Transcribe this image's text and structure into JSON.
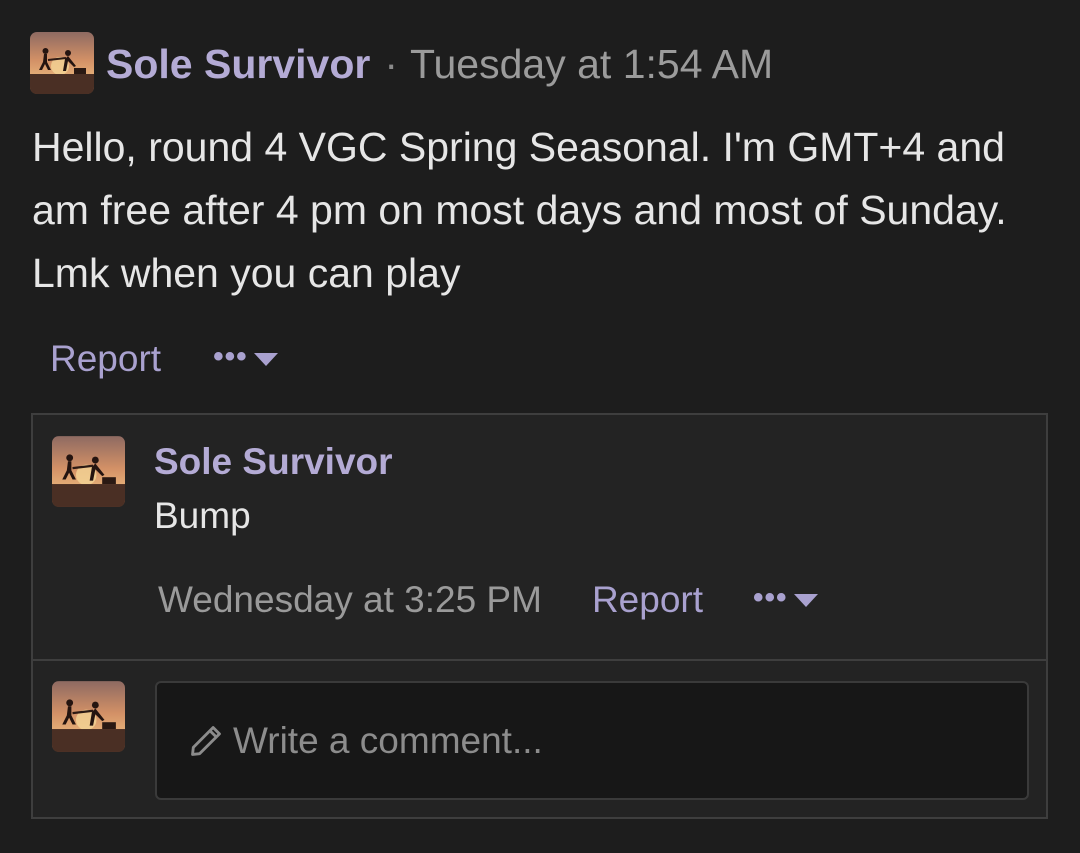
{
  "post": {
    "author": "Sole Survivor",
    "separator": "·",
    "timestamp": "Tuesday at 1:54 AM",
    "body": "Hello, round 4 VGC Spring Seasonal. I'm GMT+4 and am free after 4 pm on most days and most of Sunday. Lmk when you can play",
    "actions": {
      "report_label": "Report",
      "more_label": "•••",
      "more_icon": "caret-down-icon"
    }
  },
  "comment": {
    "author": "Sole Survivor",
    "text": "Bump",
    "timestamp": "Wednesday at 3:25 PM",
    "actions": {
      "report_label": "Report",
      "more_label": "•••",
      "more_icon": "caret-down-icon"
    }
  },
  "reply": {
    "placeholder": "Write a comment...",
    "icon": "pencil-icon"
  },
  "colors": {
    "background": "#1d1d1d",
    "panel": "#232323",
    "accent": "#b4abd5",
    "muted": "#9b9b9b",
    "text": "#e6e6e6"
  }
}
